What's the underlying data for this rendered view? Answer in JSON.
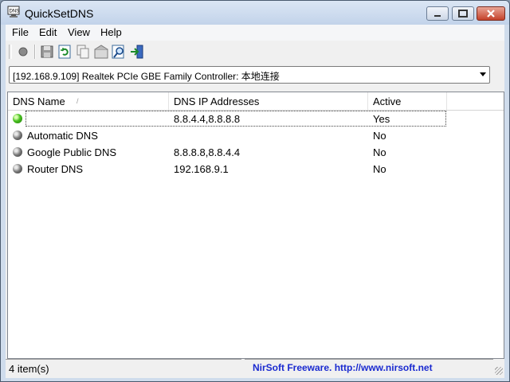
{
  "window": {
    "title": "QuickSetDNS",
    "icon": "dns-app-icon"
  },
  "menu": [
    "File",
    "Edit",
    "View",
    "Help"
  ],
  "toolbar": {
    "buttons": [
      {
        "name": "record-button",
        "icon": "circle-icon"
      },
      {
        "name": "save-button",
        "icon": "floppy-icon"
      },
      {
        "name": "refresh-button",
        "icon": "refresh-icon"
      },
      {
        "name": "copy-button",
        "icon": "copy-icon"
      },
      {
        "name": "properties-button",
        "icon": "properties-icon"
      },
      {
        "name": "find-button",
        "icon": "find-icon"
      },
      {
        "name": "exit-button",
        "icon": "exit-icon"
      }
    ]
  },
  "adapter": {
    "selected": "[192.168.9.109]  Realtek PCIe GBE Family Controller: 本地连接"
  },
  "table": {
    "columns": [
      "DNS Name",
      "DNS IP Addresses",
      "Active"
    ],
    "rows": [
      {
        "status": "active",
        "name": "",
        "ips": "8.8.4.4,8.8.8.8",
        "active": "Yes"
      },
      {
        "status": "inactive",
        "name": "Automatic DNS",
        "ips": "",
        "active": "No"
      },
      {
        "status": "inactive",
        "name": "Google Public DNS",
        "ips": "8.8.8.8,8.8.4.4",
        "active": "No"
      },
      {
        "status": "inactive",
        "name": "Router DNS",
        "ips": "192.168.9.1",
        "active": "No"
      }
    ]
  },
  "status": {
    "count": "4 item(s)",
    "link": "NirSoft Freeware.  http://www.nirsoft.net"
  },
  "colors": {
    "active": "#48c020",
    "inactive": "#5a5a5a",
    "link": "#1a2ad0"
  }
}
